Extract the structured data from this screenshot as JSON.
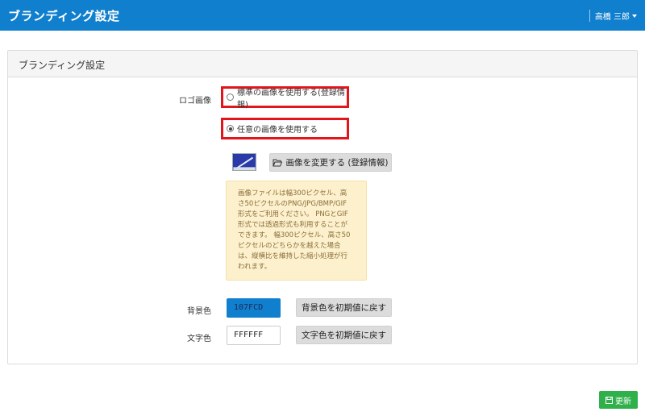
{
  "header": {
    "title": "ブランディング設定",
    "user_name": "高橋 三郎"
  },
  "panel": {
    "title": "ブランディング設定"
  },
  "logo": {
    "label": "ロゴ画像",
    "option_default": "標準の画像を使用する(登録情報)",
    "option_custom": "任意の画像を使用する",
    "selected": "custom",
    "change_button": "画像を変更する (登録情報)",
    "note_lines": [
      "画像ファイルは幅300ピクセル、高",
      "さ50ピクセルのPNG/JPG/BMP/GIF",
      "形式をご利用ください。 PNGとGIF",
      "形式では透過形式も利用することが",
      "できます。 幅300ピクセル、高さ50",
      "ピクセルのどちらかを越えた場合",
      "は、縦横比を維持した縮小処理が行",
      "われます。"
    ]
  },
  "background_color": {
    "label": "背景色",
    "value": "107FCD",
    "reset_button": "背景色を初期値に戻す",
    "swatch": "#107FCD"
  },
  "text_color": {
    "label": "文字色",
    "value": "FFFFFF",
    "reset_button": "文字色を初期値に戻す"
  },
  "footer": {
    "update_button": "更新"
  },
  "icons": {
    "folder": "folder-open-icon",
    "save": "save-icon",
    "caret": "caret-down-icon"
  }
}
